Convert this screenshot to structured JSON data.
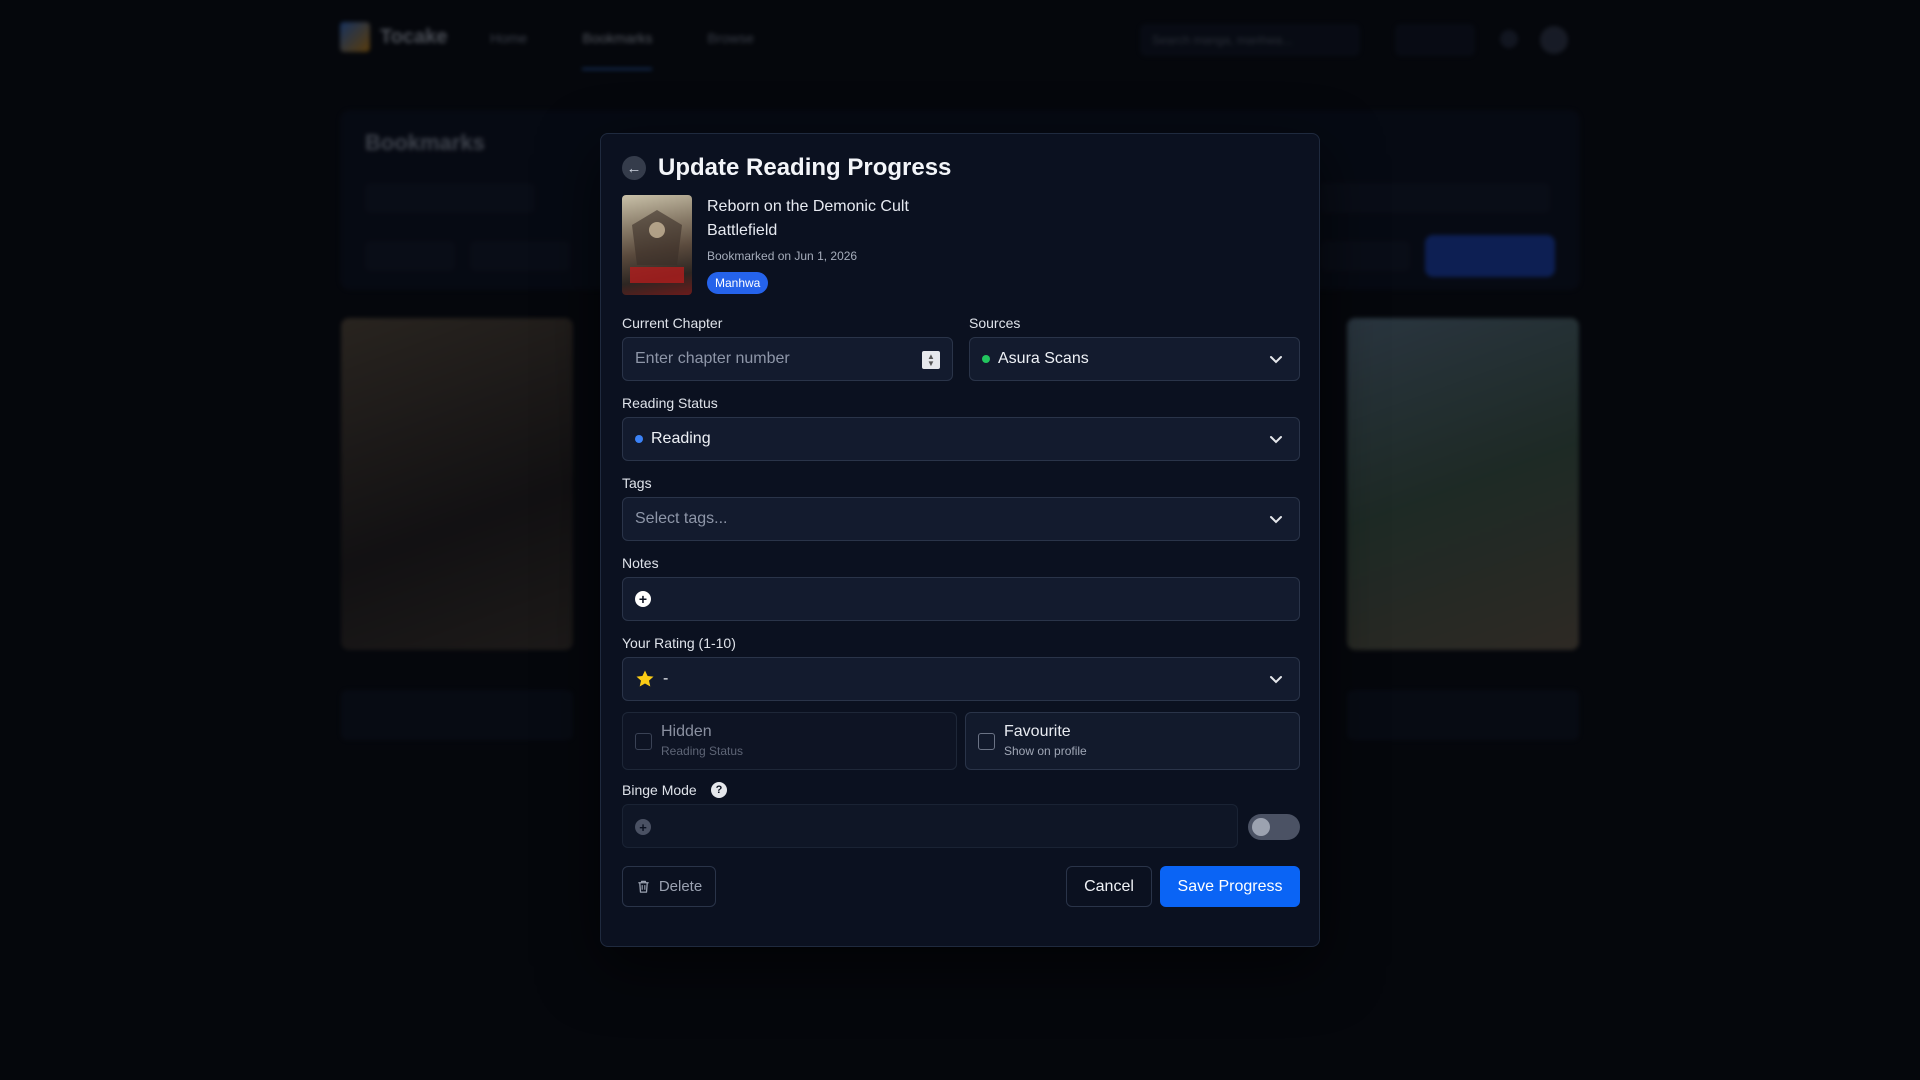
{
  "background": {
    "logo_text": "Tocake",
    "nav": [
      "Home",
      "Bookmarks",
      "Browse"
    ],
    "search_placeholder": "Search manga, manhwa...",
    "page_title": "Bookmarks"
  },
  "modal": {
    "title": "Update Reading Progress",
    "series": {
      "title": "Reborn on the Demonic Cult Battlefield",
      "bookmarked": "Bookmarked on Jun 1, 2026",
      "type": "Manhwa"
    },
    "current_chapter": {
      "label": "Current Chapter",
      "placeholder": "Enter chapter number",
      "value": ""
    },
    "sources": {
      "label": "Sources",
      "value": "Asura Scans",
      "dot_color": "#22c55e"
    },
    "reading_status": {
      "label": "Reading Status",
      "value": "Reading",
      "dot_color": "#3b82f6"
    },
    "tags": {
      "label": "Tags",
      "placeholder": "Select tags..."
    },
    "notes": {
      "label": "Notes"
    },
    "rating": {
      "label": "Your Rating (1-10)",
      "value": "-"
    },
    "hidden": {
      "title": "Hidden",
      "subtitle": "Reading Status"
    },
    "favourite": {
      "title": "Favourite",
      "subtitle": "Show on profile"
    },
    "binge_mode": {
      "label": "Binge Mode"
    },
    "buttons": {
      "delete": "Delete",
      "cancel": "Cancel",
      "save": "Save Progress"
    }
  },
  "colors": {
    "accent": "#0a64f5",
    "badge": "#2563eb"
  }
}
